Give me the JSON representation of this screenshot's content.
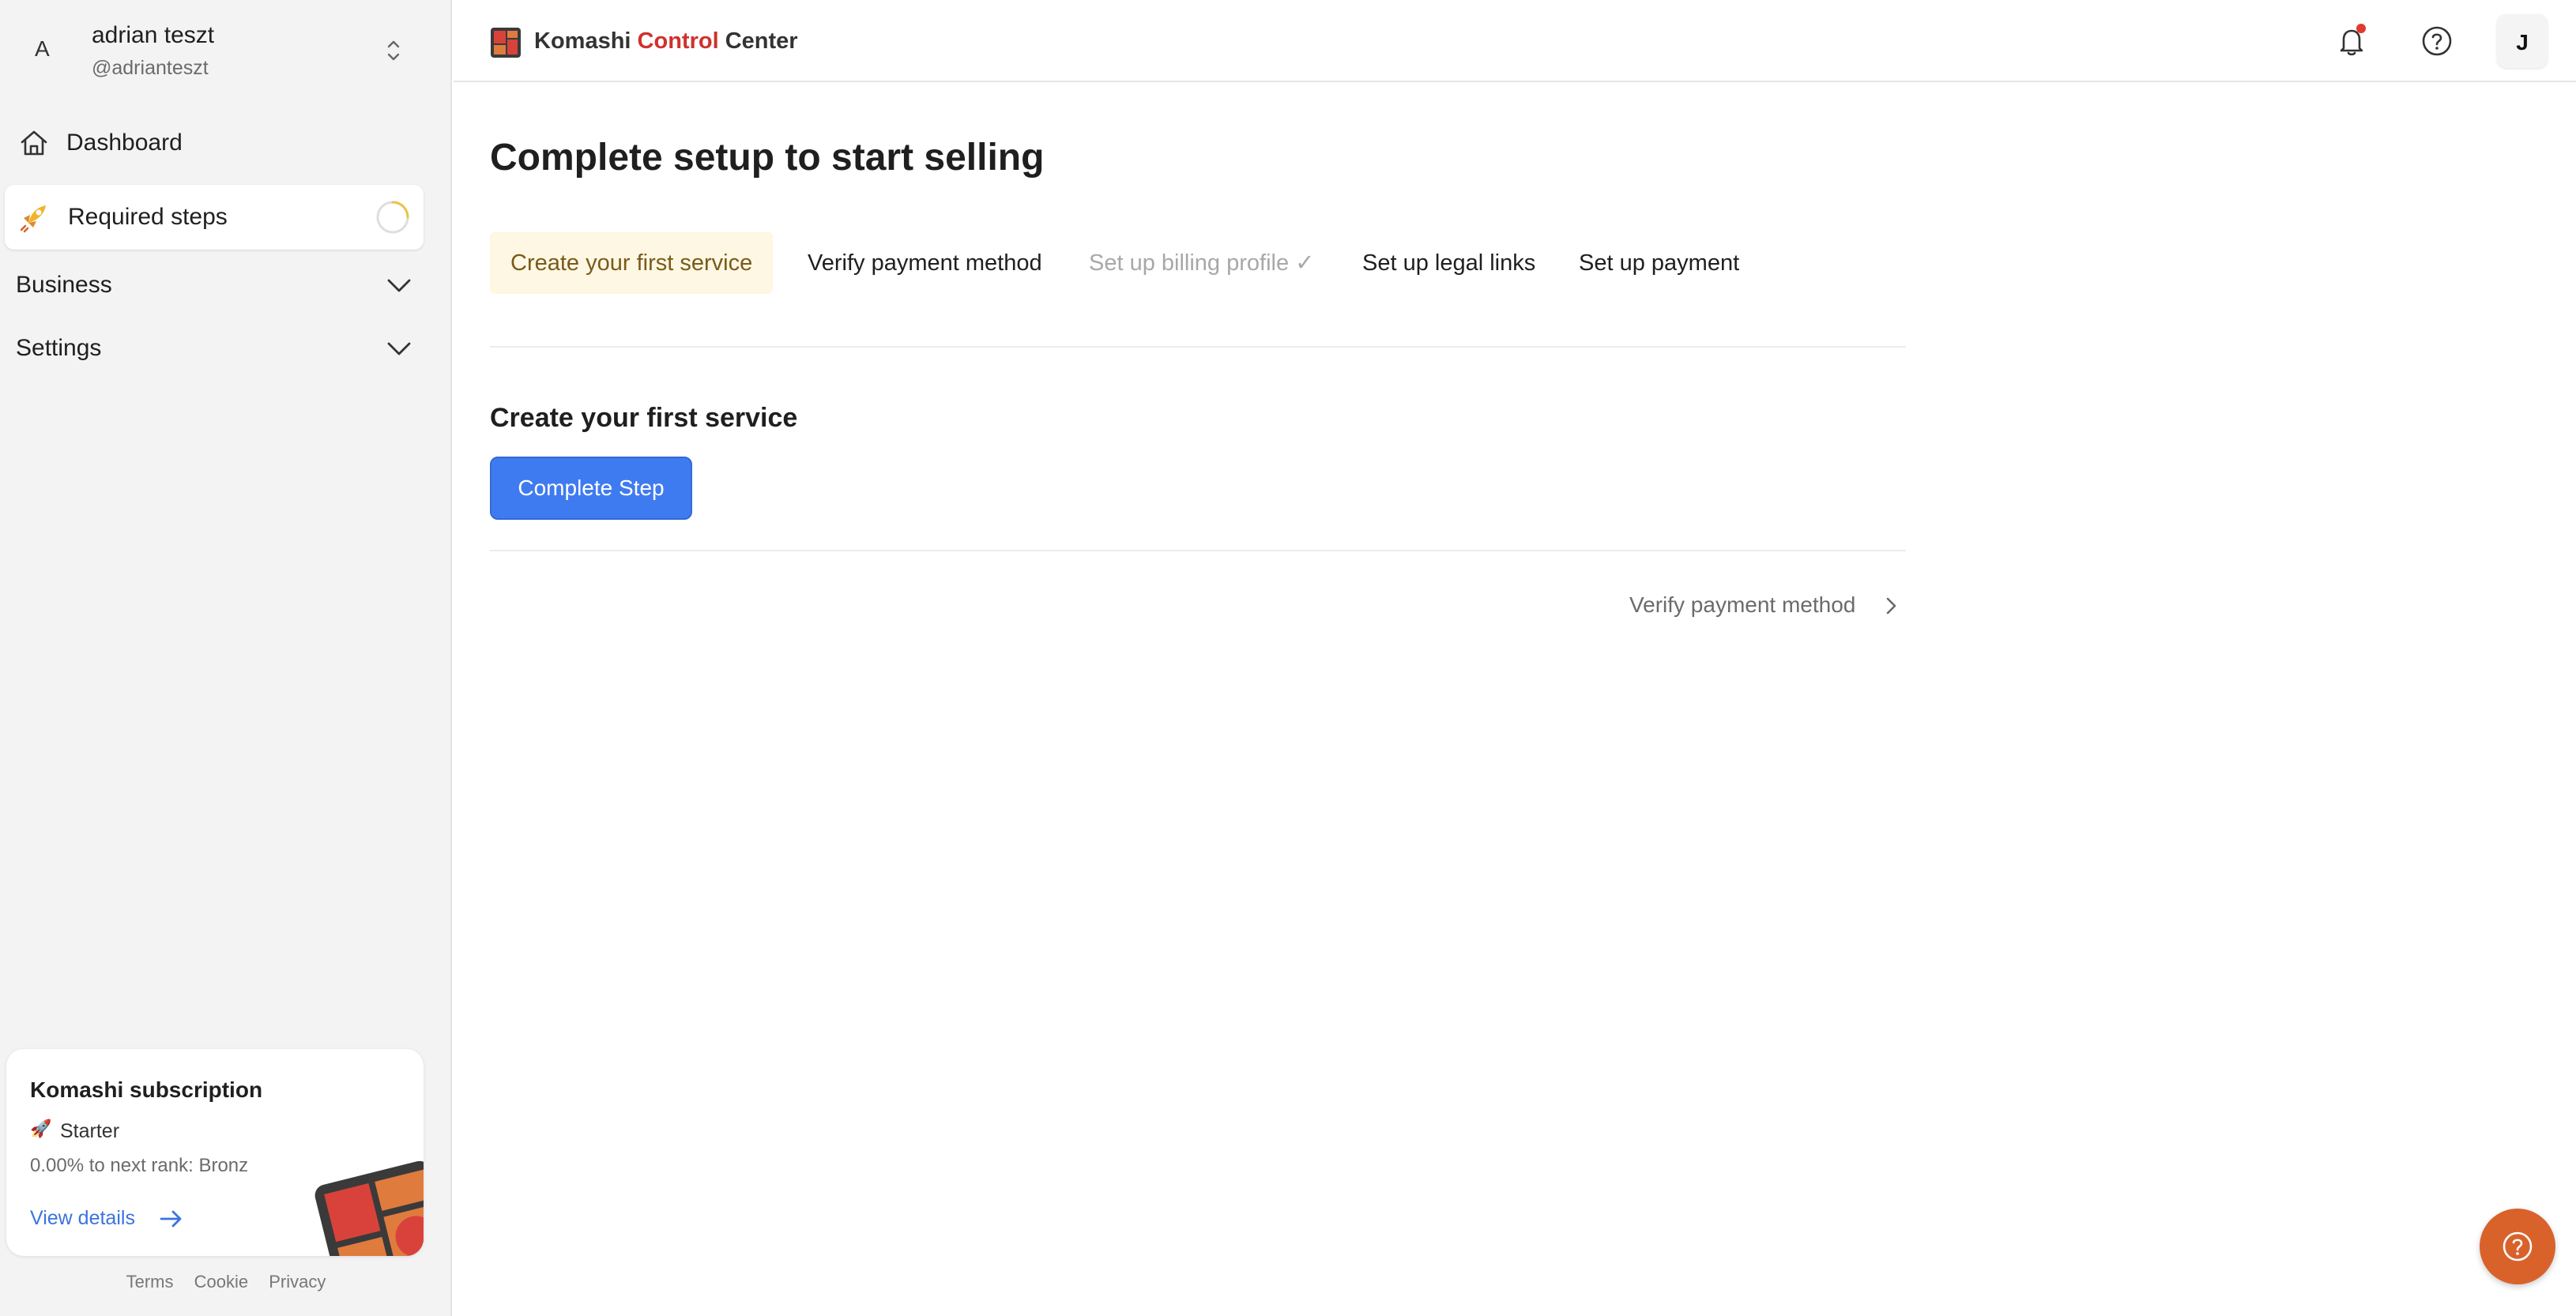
{
  "account": {
    "initial": "A",
    "name": "adrian teszt",
    "handle": "@adrianteszt"
  },
  "sidebar": {
    "dashboard_label": "Dashboard",
    "required_label": "Required steps",
    "sections": [
      {
        "label": "Business"
      },
      {
        "label": "Settings"
      }
    ]
  },
  "subscription": {
    "title": "Komashi subscription",
    "plan_icon": "rocket-icon",
    "plan": "Starter",
    "rank_text": "0.00% to next rank: Bronz",
    "view_details": "View details"
  },
  "footer": {
    "terms": "Terms",
    "cookie": "Cookie",
    "privacy": "Privacy"
  },
  "header": {
    "brand_part1": "Komashi",
    "brand_part2": "Control",
    "brand_part3": "Center",
    "user_initial": "J"
  },
  "main": {
    "page_title": "Complete setup to start selling",
    "steps": [
      {
        "label": "Create your first service",
        "state": "active"
      },
      {
        "label": "Verify payment method",
        "state": "pending"
      },
      {
        "label": "Set up billing profile ✓",
        "state": "done"
      },
      {
        "label": "Set up legal links",
        "state": "pending"
      },
      {
        "label": "Set up payment",
        "state": "pending"
      }
    ],
    "section_title": "Create your first service",
    "complete_button": "Complete Step",
    "next_link": "Verify payment method"
  },
  "colors": {
    "accent_blue": "#3f7bf0",
    "brand_red": "#d0312d",
    "fab_orange": "#d9622b",
    "active_step_bg": "#fdf7e3"
  }
}
